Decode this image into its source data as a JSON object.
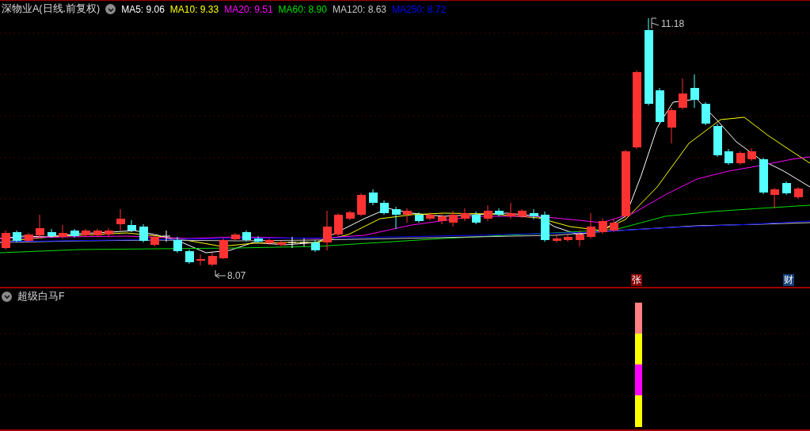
{
  "price_pane": {
    "title": "深物业A(日线.前复权)",
    "ma_legend": [
      {
        "label": "MA5:",
        "value": "9.06",
        "color": "#ffffff"
      },
      {
        "label": "MA10:",
        "value": "9.33",
        "color": "#ffff00"
      },
      {
        "label": "MA20:",
        "value": "9.51",
        "color": "#ff00ff"
      },
      {
        "label": "MA60:",
        "value": "8.90",
        "color": "#00e000"
      },
      {
        "label": "MA120:",
        "value": "8.63",
        "color": "#c8c8c8"
      },
      {
        "label": "MA250:",
        "value": "8.72",
        "color": "#0000ff"
      }
    ],
    "high_label": "11.18",
    "low_label": "8.07",
    "event_markers": [
      {
        "text": "张",
        "color": "#8b0000"
      },
      {
        "text": "财",
        "color": "#14407a"
      }
    ]
  },
  "indicator_pane": {
    "title": "超级白马F"
  }
}
